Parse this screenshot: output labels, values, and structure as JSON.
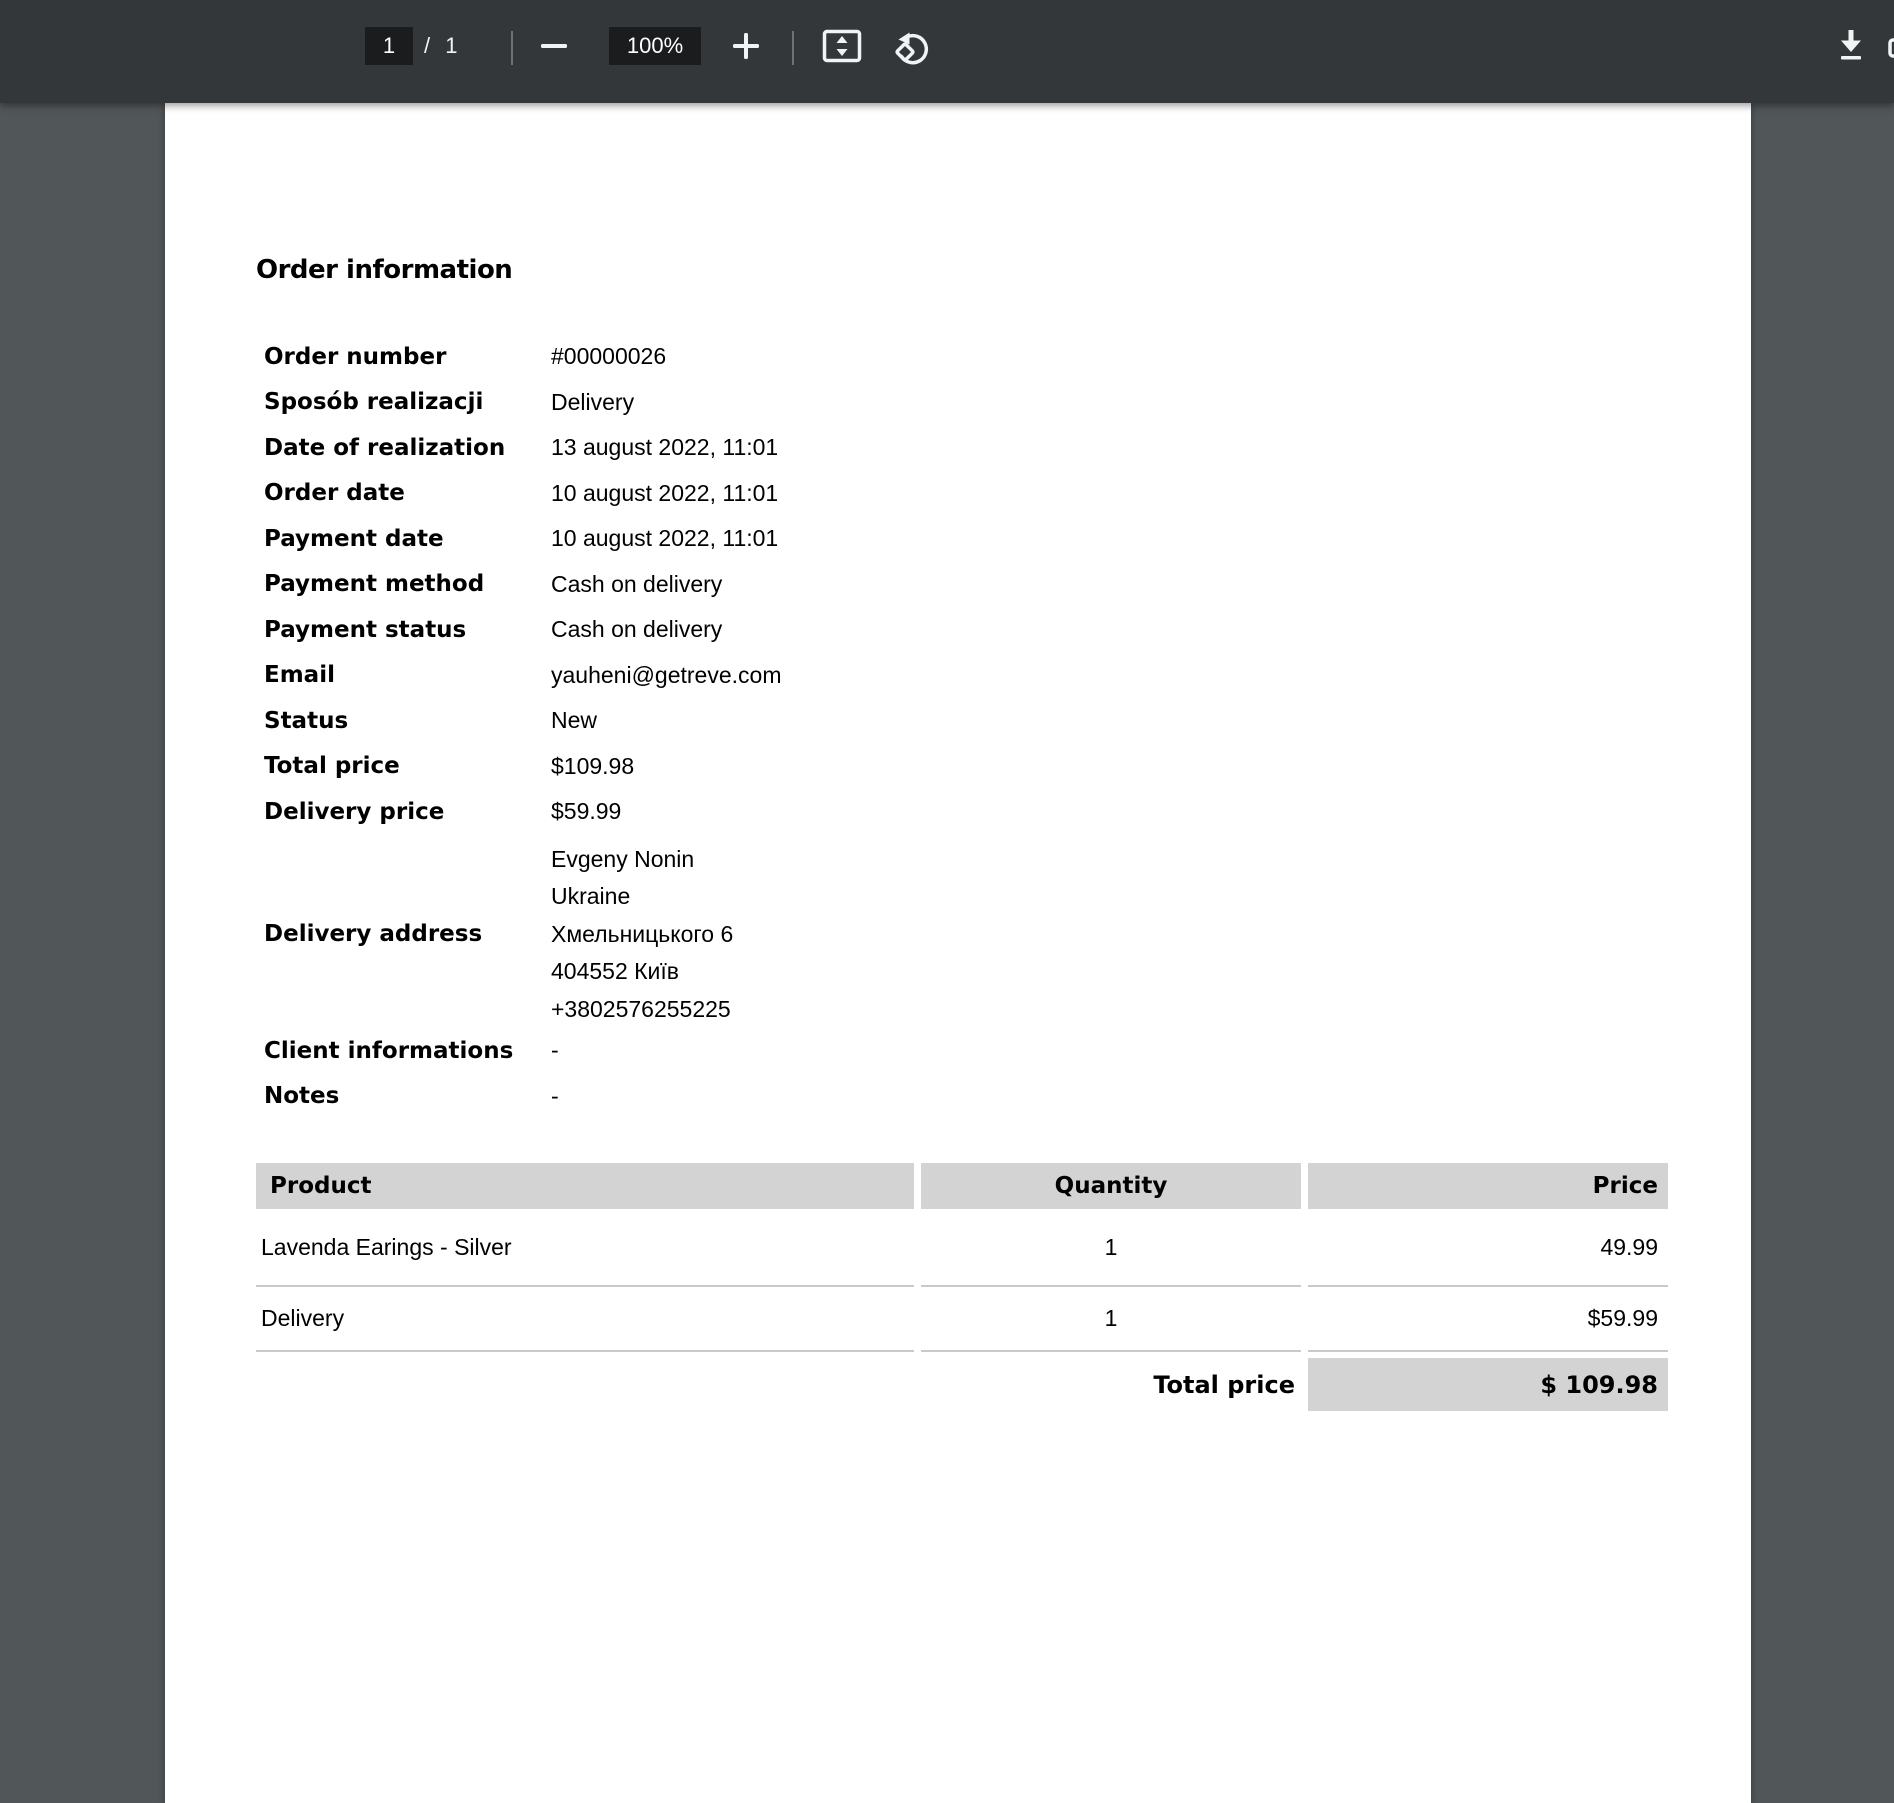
{
  "toolbar": {
    "page_current": "1",
    "page_of": "/ 1",
    "zoom_level": "100%"
  },
  "document": {
    "title": "Order information",
    "fields": [
      {
        "label": "Order number",
        "value": "#00000026"
      },
      {
        "label": "Sposób realizacji",
        "value": "Delivery"
      },
      {
        "label": "Date of realization",
        "value": "13 august 2022, 11:01"
      },
      {
        "label": "Order date",
        "value": "10 august 2022, 11:01"
      },
      {
        "label": "Payment date",
        "value": "10 august 2022, 11:01"
      },
      {
        "label": "Payment method",
        "value": "Cash on delivery"
      },
      {
        "label": "Payment status",
        "value": "Cash on delivery"
      },
      {
        "label": "Email",
        "value": "yauheni@getreve.com"
      },
      {
        "label": "Status",
        "value": "New"
      },
      {
        "label": "Total price",
        "value": "$109.98"
      },
      {
        "label": "Delivery price",
        "value": "$59.99"
      },
      {
        "label": "Delivery address",
        "value": [
          "Evgeny Nonin",
          "Ukraine",
          "Хмельницького 6",
          "404552 Київ",
          "+3802576255225"
        ]
      },
      {
        "label": "Client informations",
        "value": "-"
      },
      {
        "label": "Notes",
        "value": "-"
      }
    ],
    "table": {
      "headers": {
        "product": "Product",
        "quantity": "Quantity",
        "price": "Price"
      },
      "rows": [
        {
          "product": "Lavenda Earings - Silver",
          "quantity": "1",
          "price": "49.99"
        },
        {
          "product": "Delivery",
          "quantity": "1",
          "price": "$59.99"
        }
      ],
      "total_label": "Total price",
      "total_value": "$ 109.98"
    }
  },
  "colors": {
    "toolbar_bg": "#33373a",
    "toolbar_field_bg": "#1a1c1e",
    "viewer_bg": "#515659",
    "page_bg": "#ffffff",
    "table_header_bg": "#d3d3d3",
    "row_divider": "#c9c9c9",
    "toolbar_icon": "#f1f3f4"
  }
}
